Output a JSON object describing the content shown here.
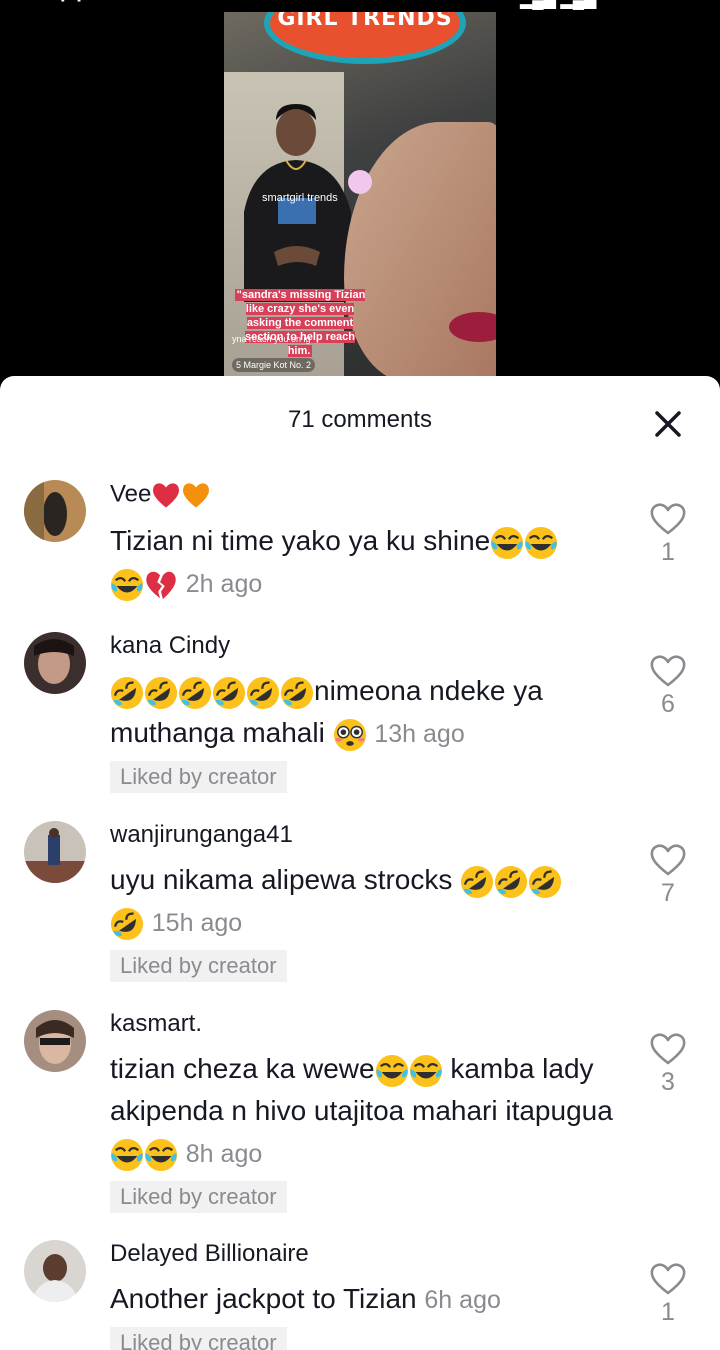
{
  "video": {
    "logo_text": "GIRL TRENDS",
    "watermark": "smartgirl trends",
    "caption": "\"sandra's missing Tizian like crazy she's even asking the comment section to help reach him.",
    "sub_caption": "yna reach you on ig",
    "live_badge": "5 Margie Kot  No. 2"
  },
  "sheet": {
    "title": "71 comments",
    "close_icon": "close-icon"
  },
  "comments": [
    {
      "name": "Vee",
      "name_emoji": [
        "red-heart",
        "orange-heart"
      ],
      "text": "Tizian ni time yako ya ku shine",
      "text_emoji_after": [
        "tears-of-joy",
        "tears-of-joy",
        "tears-of-joy",
        "broken-heart"
      ],
      "time": "2h ago",
      "likes": "1",
      "liked_by_creator": ""
    },
    {
      "name": "kana Cindy",
      "text_emoji_before": [
        "rofl",
        "rofl",
        "rofl",
        "rofl",
        "rofl",
        "rofl"
      ],
      "text": "nimeona ndeke ya muthanga mahali",
      "text_emoji_after": [
        "flushed"
      ],
      "time": "13h ago",
      "likes": "6",
      "liked_by_creator": "Liked by creator"
    },
    {
      "name": "wanjirunganga41",
      "text": "uyu nikama alipewa strocks",
      "text_emoji_after": [
        "rofl",
        "rofl",
        "rofl",
        "rofl"
      ],
      "time": "15h ago",
      "likes": "7",
      "liked_by_creator": "Liked by creator"
    },
    {
      "name": "kasmart.",
      "text_part1": "tizian cheza ka wewe",
      "text_part2": "kamba lady akipenda n hivo utajitoa mahari itapugua",
      "time": "8h ago",
      "likes": "3",
      "liked_by_creator": "Liked by creator"
    },
    {
      "name": "Delayed Billionaire",
      "text": "Another jackpot to Tizian",
      "time": "6h ago",
      "likes": "1",
      "liked_by_creator": "Liked by creator"
    }
  ],
  "colors": {
    "heart_outline": "#8a8b91",
    "secondary_text": "#8a8b91",
    "primary_text": "#161823",
    "liked_bg": "#f1f1f2"
  }
}
